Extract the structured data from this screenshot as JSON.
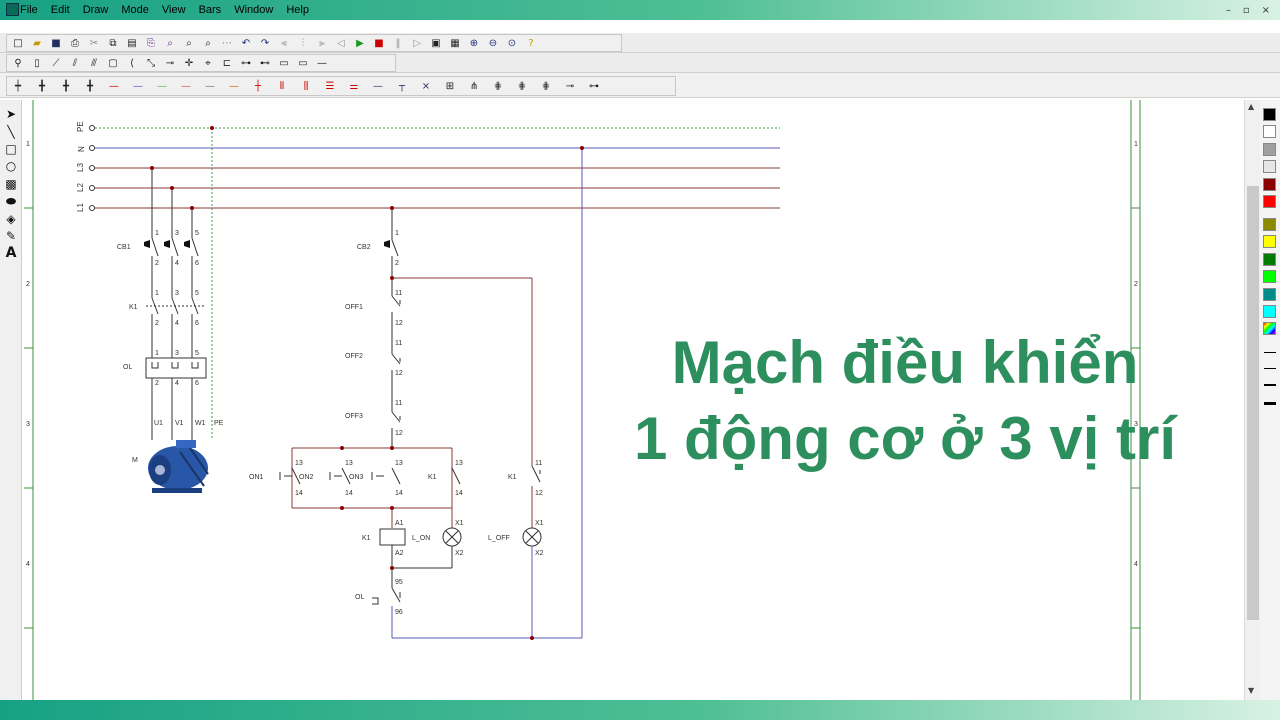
{
  "menu": {
    "items": [
      "File",
      "Edit",
      "Draw",
      "Mode",
      "View",
      "Bars",
      "Window",
      "Help"
    ],
    "window_controls": [
      "–",
      "▫",
      "×"
    ]
  },
  "headline": {
    "line1": "Mạch điều khiển",
    "line2": "1 động cơ ở 3 vị trí",
    "color": "#2e8f5e"
  },
  "schematic": {
    "supply_labels": [
      "PE",
      "N",
      "L3",
      "L2",
      "L1"
    ],
    "row_numbers": [
      "1",
      "2",
      "3",
      "4"
    ],
    "power": {
      "cb": "CB1",
      "contactor": "K1",
      "overload": "OL",
      "motor": "M",
      "motor_terminals": [
        "U1",
        "V1",
        "W1",
        "PE"
      ],
      "top_terminals": [
        "1",
        "3",
        "5"
      ],
      "bottom_terminals": [
        "2",
        "4",
        "6"
      ]
    },
    "control": {
      "cb": "CB2",
      "cb_terminals": [
        "1",
        "2"
      ],
      "stops": [
        "OFF1",
        "OFF2",
        "OFF3"
      ],
      "nc_terminals": [
        "11",
        "12"
      ],
      "starts": [
        "ON1",
        "ON2",
        "ON3"
      ],
      "hold": "K1",
      "no_terminals": [
        "13",
        "14"
      ],
      "coil": "K1",
      "coil_terminals": [
        "A1",
        "A2"
      ],
      "lamp_on": "L_ON",
      "lamp_off": "L_OFF",
      "lamp_terminals": [
        "X1",
        "X2"
      ],
      "aux_nc": "K1",
      "ol_contact": "OL",
      "ol_terminals": [
        "95",
        "96"
      ]
    }
  },
  "colors": {
    "band": "#17a184",
    "phase_line": "#8b3a3a",
    "neutral_line": "#5757b8",
    "pe_line": "#3f9a3f",
    "node": "#8b0000"
  },
  "palette_colors": [
    "#000000",
    "#ffffff",
    "#a0a0a0",
    "#e6e6e6",
    "#8b0000",
    "#ff0000",
    "#8b8b00",
    "#ffff00",
    "#007a00",
    "#00ff00",
    "#008b8b",
    "#00ffff"
  ]
}
